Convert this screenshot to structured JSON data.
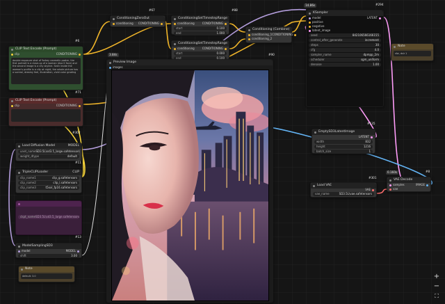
{
  "nodes": {
    "combine_top": {
      "title": "ConditioningZeroOut",
      "badge": "#67",
      "in_label": "conditioning",
      "out_label": "CONDITIONING"
    },
    "set_range_1": {
      "title": "ConditioningSetTimestepRange",
      "badge": "#88",
      "in_label": "conditioning",
      "out_label": "CONDITIONING",
      "start_label": "start",
      "start": "0.100",
      "end_label": "end",
      "end": "1.000"
    },
    "set_range_2": {
      "title": "ConditioningSetTimestepRange",
      "badge": "#89",
      "in_label": "conditioning",
      "out_label": "CONDITIONING",
      "start_label": "start",
      "start": "0.000",
      "end_label": "end",
      "end": "0.100"
    },
    "cond_combine": {
      "title": "Conditioning (Combine)",
      "badge": "#90",
      "in1": "conditioning_1",
      "in2": "conditioning_2",
      "out_label": "CONDITIONING"
    },
    "ksampler": {
      "title": "KSampler",
      "badge": "#294",
      "timing": "14.86s",
      "inputs": [
        "model",
        "positive",
        "negative",
        "latent_image"
      ],
      "out_label": "LATENT",
      "widgets": [
        {
          "label": "seed",
          "value": "842106566166155"
        },
        {
          "label": "control_after_generate",
          "value": "increment"
        },
        {
          "label": "steps",
          "value": "30"
        },
        {
          "label": "cfg",
          "value": "4.0"
        },
        {
          "label": "sampler_name",
          "value": "dpmpp_2m"
        },
        {
          "label": "scheduler",
          "value": "sgm_uniform"
        },
        {
          "label": "denoise",
          "value": "1.00"
        }
      ]
    },
    "note_top": {
      "title": "Note",
      "text": "sfw, dslr 1"
    },
    "clip_pos": {
      "title": "CLIP Text Encode (Prompt)",
      "badge": "#6",
      "in_label": "clip",
      "out_label": "CONDITIONING",
      "text": "double exposure shot of Yorkey cosmetic poster, the first portrait is a close-up of a woman (Ava K face) and the second image is a city skyline. Seen inside the woman's profile is a city at night, the whole picture has a surreal, dreamy feel, illustration, vivid color grading"
    },
    "clip_neg": {
      "title": "CLIP Text Encode (Prompt)",
      "badge": "#71",
      "in_label": "clip",
      "out_label": "CONDITIONING",
      "text": ""
    },
    "preview": {
      "title": "Preview Image",
      "badge": "#302",
      "timing": "3.84s",
      "in_label": "images"
    },
    "load_diffusion": {
      "title": "Load Diffusion Model",
      "out_label": "MODEL",
      "widgets": [
        {
          "label": "unet_name",
          "value": "SD3.5L\\sd3.5_large.safetensors"
        },
        {
          "label": "weight_dtype",
          "value": "default"
        }
      ]
    },
    "triple_clip": {
      "title": "TripleCLIPLoader",
      "badge": "#11",
      "out_label": "CLIP",
      "widgets": [
        {
          "label": "clip_name1",
          "value": "clip_g.safetensors"
        },
        {
          "label": "clip_name2",
          "value": "clip_l.safetensors"
        },
        {
          "label": "clip_name3",
          "value": "t5xxl_fp16.safetensors"
        }
      ]
    },
    "purple_group": {
      "badge": "#13",
      "widget_label": "ckpt_name",
      "widget_value": "SD3.5L\\sd3.5_large.safetensors"
    },
    "model_sampling": {
      "title": "ModelSamplingSD3",
      "badge": "#13",
      "in_label": "model",
      "out_label": "MODEL",
      "shift_label": "shift",
      "shift": "3.00"
    },
    "note_bottom": {
      "title": "Note",
      "text": "default: 3.0"
    },
    "empty_latent": {
      "title": "EmptySD3LatentImage",
      "badge": "#135",
      "out_label": "LATENT",
      "widgets": [
        {
          "label": "width",
          "value": "832"
        },
        {
          "label": "height",
          "value": "1216"
        },
        {
          "label": "batch_size",
          "value": "1"
        }
      ]
    },
    "load_vae": {
      "title": "Load VAE",
      "badge": "#301",
      "out_label": "VAE",
      "widgets": [
        {
          "label": "vae_name",
          "value": "SD3.5L\\vae.safetensors"
        }
      ]
    },
    "vae_decode": {
      "title": "VAE Decode",
      "badge": "#8",
      "timing": "0.160s",
      "in1": "samples",
      "in2": "vae",
      "out_label": "IMAGE"
    }
  },
  "controls": {
    "zoom_in": "+",
    "zoom_out": "−",
    "fit": "⛶"
  },
  "colors": {
    "link_conditioning": "#f0b52a",
    "link_model": "#b39ddb",
    "link_clip": "#f5d23a",
    "link_latent": "#ff9cf9",
    "link_vae": "#ff6e6e",
    "link_image": "#64b5f6"
  }
}
